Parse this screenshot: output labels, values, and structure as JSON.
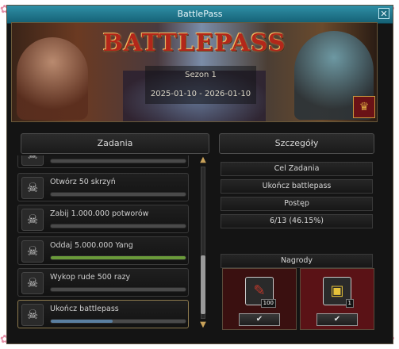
{
  "window": {
    "title": "BattlePass",
    "close_glyph": "✕"
  },
  "banner": {
    "logo": "BATTLEPASS",
    "season": "Sezon 1",
    "dates": "2025-01-10 - 2026-01-10",
    "trophy_icon": "trophy-icon"
  },
  "tasks_panel": {
    "header": "Zadania",
    "items": [
      {
        "name": "",
        "progress": 0.0,
        "color": "#6b6b6b"
      },
      {
        "name": "Otwórz 50 skrzyń",
        "progress": 0.0,
        "color": "#6b6b6b"
      },
      {
        "name": "Zabij 1.000.000 potworów",
        "progress": 0.0,
        "color": "#6b6b6b"
      },
      {
        "name": "Oddaj 5.000.000 Yang",
        "progress": 1.0,
        "color": "#6a9a3a"
      },
      {
        "name": "Wykop rude 500 razy",
        "progress": 0.0,
        "color": "#6b6b6b"
      },
      {
        "name": "Ukończ battlepass",
        "progress": 0.46,
        "color": "#5a7fa0"
      }
    ]
  },
  "details_panel": {
    "header": "Szczegóły",
    "goal_label": "Cel Zadania",
    "goal_value": "Ukończ battlepass",
    "progress_label": "Postęp",
    "progress_value": "6/13 (46.15%)",
    "rewards_label": "Nagrody",
    "rewards": [
      {
        "icon": "red-scroll-icon",
        "count": "100",
        "check": "✔",
        "bg": "#3a1010"
      },
      {
        "icon": "golden-chest-icon",
        "count": "1",
        "check": "✔",
        "bg": "#5a1216"
      }
    ]
  },
  "colors": {
    "titlebar": "#1b7086",
    "accent_gold": "#c9a25a"
  }
}
